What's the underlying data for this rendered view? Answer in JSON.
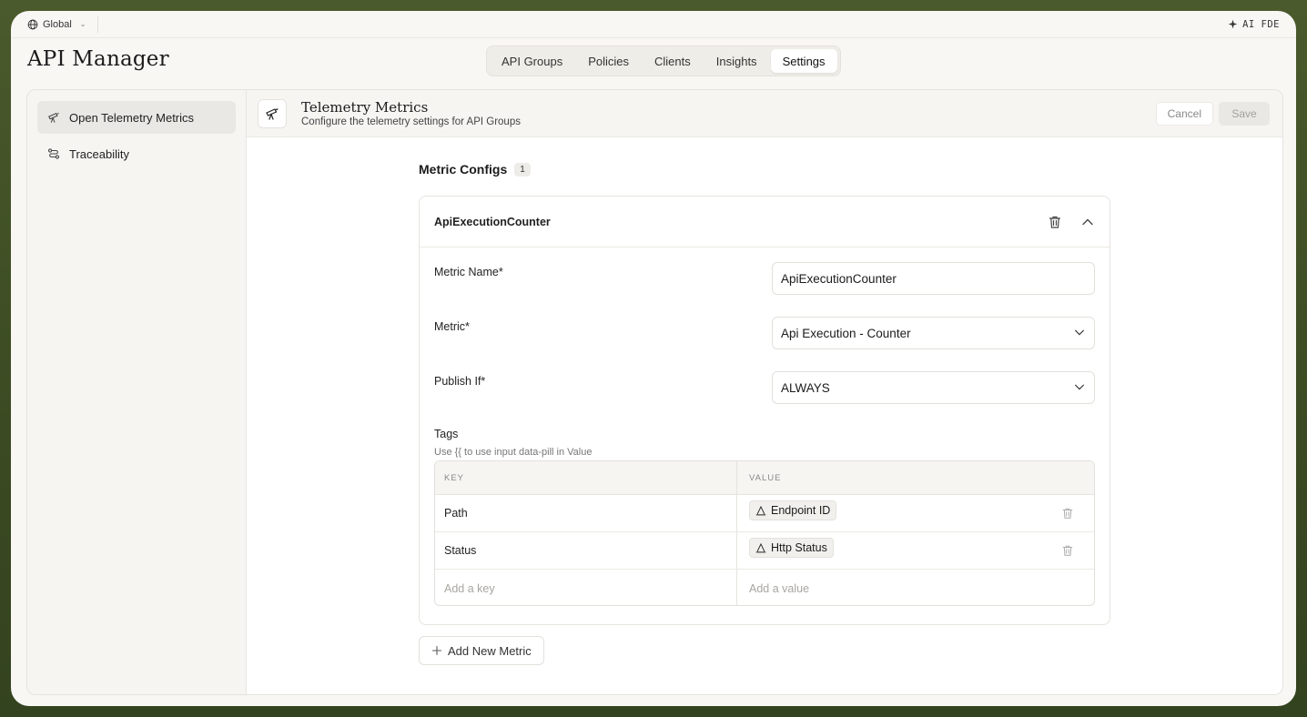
{
  "topbar": {
    "scope_label": "Global",
    "ai_label": "AI FDE"
  },
  "app": {
    "title": "API Manager"
  },
  "tabs": [
    {
      "label": "API Groups"
    },
    {
      "label": "Policies"
    },
    {
      "label": "Clients"
    },
    {
      "label": "Insights"
    },
    {
      "label": "Settings",
      "active": true
    }
  ],
  "sidebar": {
    "items": [
      {
        "label": "Open Telemetry Metrics",
        "icon": "telescope-icon",
        "active": true
      },
      {
        "label": "Traceability",
        "icon": "route-icon"
      }
    ]
  },
  "section": {
    "title": "Telemetry Metrics",
    "subtitle": "Configure the telemetry settings for API Groups",
    "cancel_label": "Cancel",
    "save_label": "Save"
  },
  "metric_configs": {
    "title": "Metric Configs",
    "count": "1",
    "card": {
      "name": "ApiExecutionCounter",
      "fields": {
        "metric_name": {
          "label": "Metric Name*",
          "value": "ApiExecutionCounter"
        },
        "metric": {
          "label": "Metric*",
          "value": "Api Execution - Counter"
        },
        "publish_if": {
          "label": "Publish If*",
          "value": "ALWAYS"
        }
      },
      "tags": {
        "label": "Tags",
        "hint": "Use {{ to use input data-pill in Value",
        "columns": {
          "key": "KEY",
          "value": "VALUE"
        },
        "rows": [
          {
            "key": "Path",
            "value": "Endpoint ID"
          },
          {
            "key": "Status",
            "value": "Http Status"
          }
        ],
        "key_placeholder": "Add a key",
        "value_placeholder": "Add a value"
      }
    },
    "add_label": "Add New Metric"
  }
}
